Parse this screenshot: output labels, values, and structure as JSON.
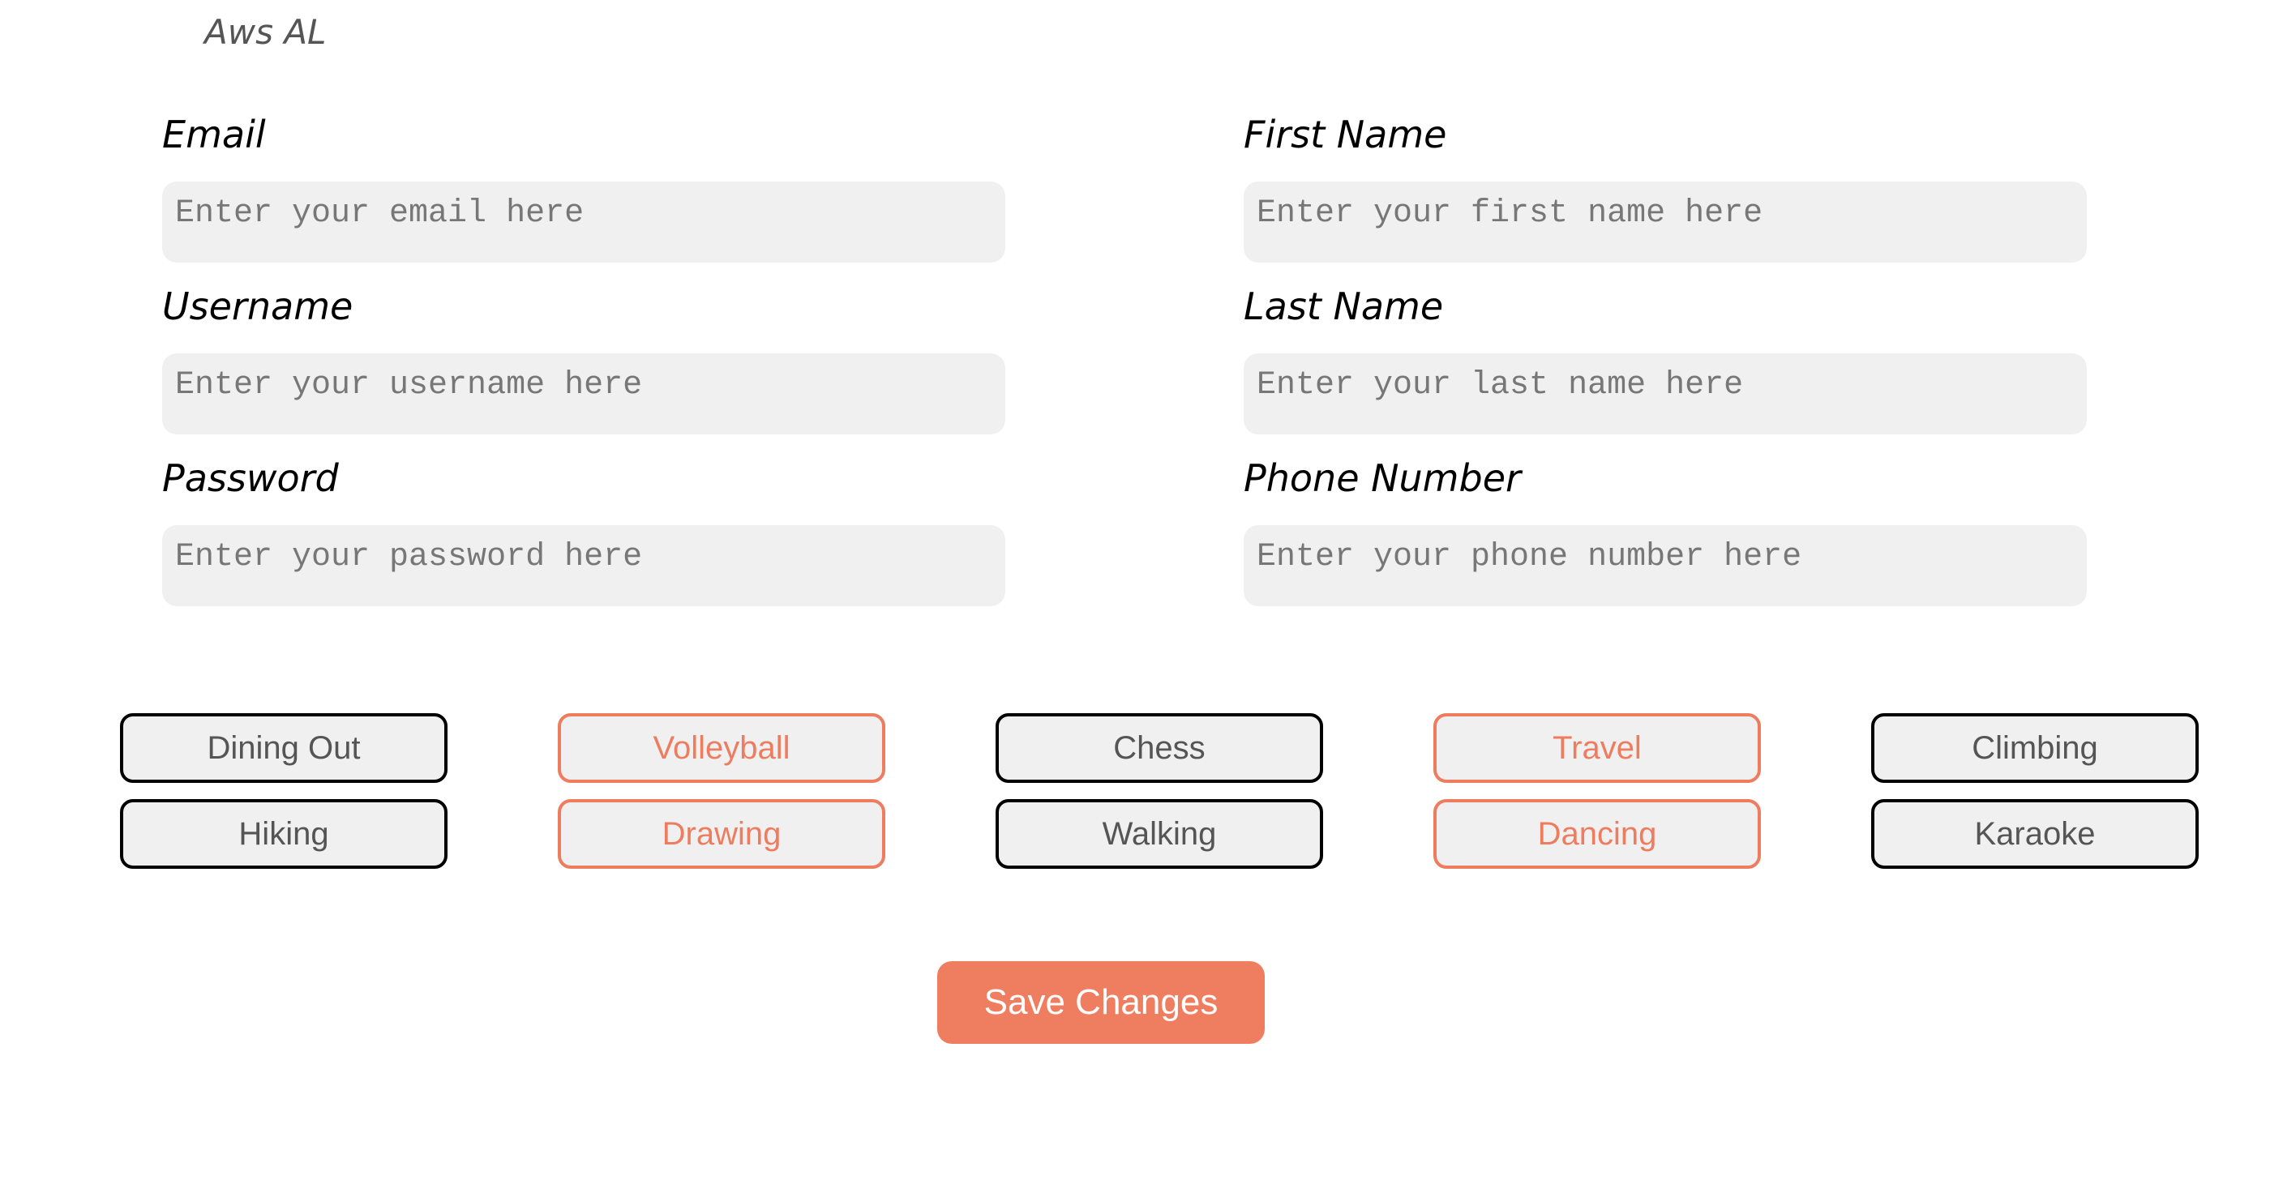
{
  "header": {
    "user_name": "Aws AL"
  },
  "form": {
    "email": {
      "label": "Email",
      "placeholder": "Enter your email here",
      "value": ""
    },
    "username": {
      "label": "Username",
      "placeholder": "Enter your username here",
      "value": ""
    },
    "password": {
      "label": "Password",
      "placeholder": "Enter your password here",
      "value": ""
    },
    "first_name": {
      "label": "First Name",
      "placeholder": "Enter your first name here",
      "value": ""
    },
    "last_name": {
      "label": "Last Name",
      "placeholder": "Enter your last name here",
      "value": ""
    },
    "phone_number": {
      "label": "Phone Number",
      "placeholder": "Enter your phone number here",
      "value": ""
    }
  },
  "interests": [
    {
      "label": "Dining Out",
      "selected": false
    },
    {
      "label": "Volleyball",
      "selected": true
    },
    {
      "label": "Chess",
      "selected": false
    },
    {
      "label": "Travel",
      "selected": true
    },
    {
      "label": "Climbing",
      "selected": false
    },
    {
      "label": "Hiking",
      "selected": false
    },
    {
      "label": "Drawing",
      "selected": true
    },
    {
      "label": "Walking",
      "selected": false
    },
    {
      "label": "Dancing",
      "selected": true
    },
    {
      "label": "Karaoke",
      "selected": false
    }
  ],
  "actions": {
    "save_label": "Save Changes"
  },
  "colors": {
    "accent": "#ef7d5f",
    "input_background": "#f0f0f0",
    "tag_border_default": "#000000",
    "tag_text_default": "#555555"
  }
}
